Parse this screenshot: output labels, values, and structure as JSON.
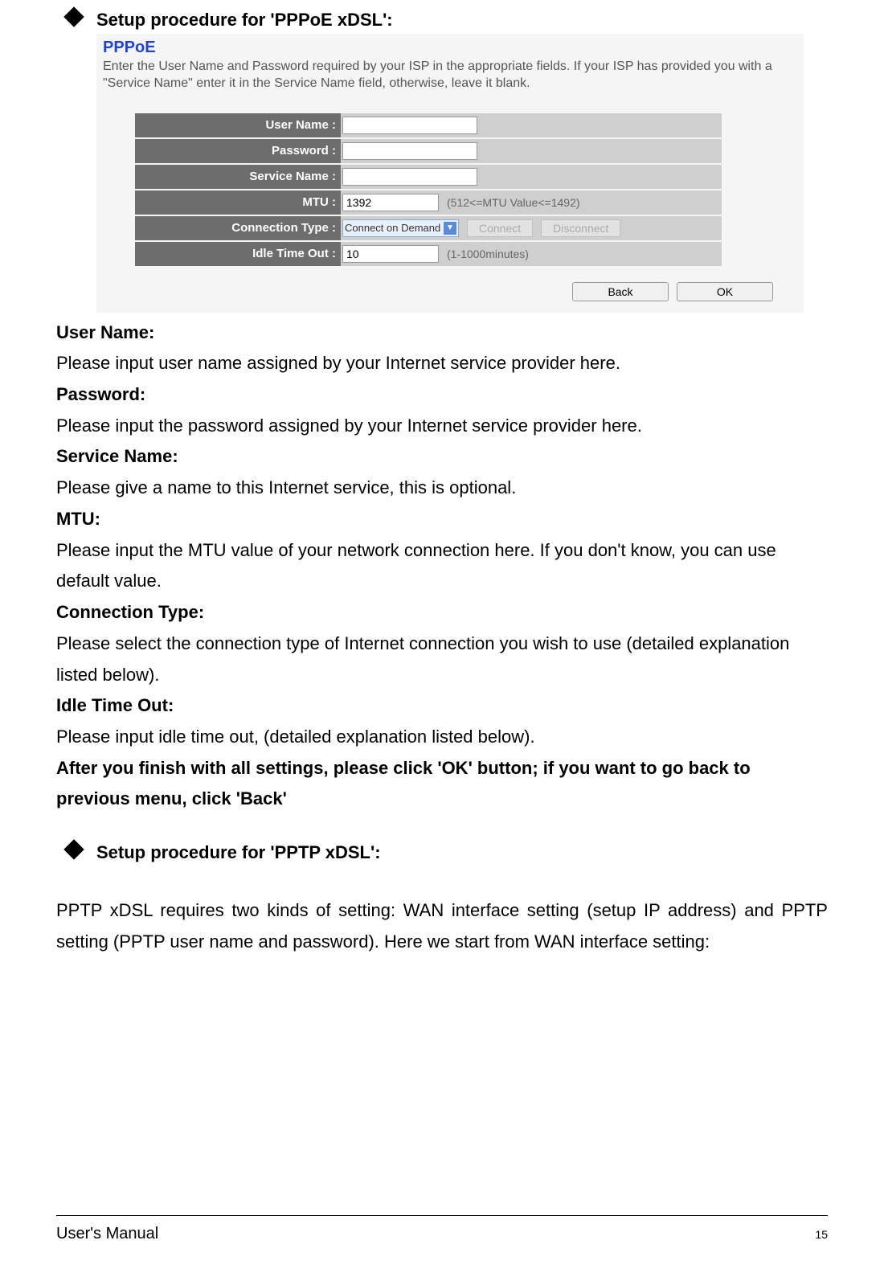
{
  "heading1": "Setup procedure for 'PPPoE xDSL':",
  "screenshot": {
    "title": "PPPoE",
    "description": "Enter the User Name and Password required by your ISP in the appropriate fields. If your ISP has provided you with a \"Service Name\" enter it in the Service Name field, otherwise, leave it blank.",
    "labels": {
      "user": "User Name :",
      "password": "Password :",
      "service": "Service Name :",
      "mtu": "MTU :",
      "conn": "Connection Type :",
      "idle": "Idle Time Out :"
    },
    "values": {
      "user": "",
      "password": "",
      "service": "",
      "mtu": "1392",
      "conn_selected": "Connect on Demand",
      "idle": "10"
    },
    "hints": {
      "mtu": "(512<=MTU Value<=1492)",
      "idle": "(1-1000minutes)"
    },
    "buttons": {
      "connect": "Connect",
      "disconnect": "Disconnect",
      "back": "Back",
      "ok": "OK"
    }
  },
  "definitions": {
    "user_t": "User Name:",
    "user_d": "Please input user name assigned by your Internet service provider here.",
    "password_t": "Password:",
    "password_d": "Please input the password assigned by your Internet service provider here.",
    "service_t": "Service Name:",
    "service_d": "Please give a name to this Internet service, this is optional.",
    "mtu_t": "MTU:",
    "mtu_d": "Please input the MTU value of your network connection here. If you don't know, you can use default value.",
    "conn_t": "Connection Type:",
    "conn_d": "Please select the connection type of Internet connection you wish to use (detailed explanation listed below).",
    "idle_t": "Idle Time Out:",
    "idle_d": "Please input idle time out, (detailed explanation listed below).",
    "final": "After you finish with all settings, please click 'OK' button; if you want to go back to previous menu, click 'Back'"
  },
  "heading2": "Setup procedure for 'PPTP xDSL':",
  "para2": "PPTP xDSL requires two kinds of setting: WAN interface setting (setup IP address) and PPTP setting (PPTP user name and password). Here we start from WAN interface setting:",
  "footer": {
    "left": "User's Manual",
    "page": "15"
  }
}
